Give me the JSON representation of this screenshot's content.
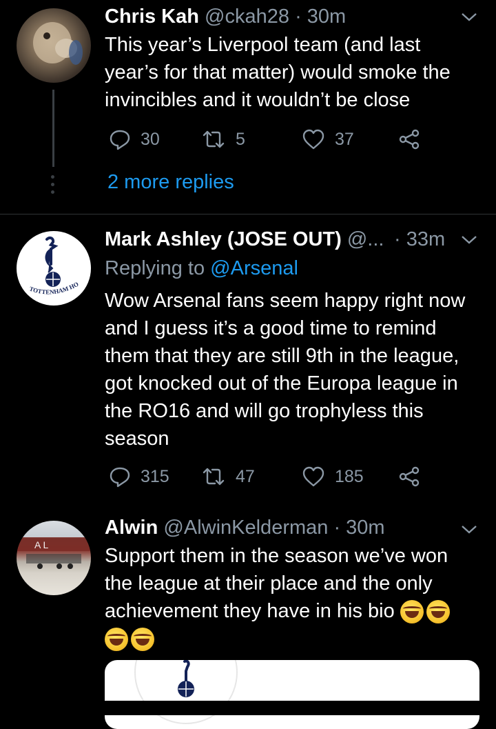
{
  "tweets": [
    {
      "name": "Chris Kah",
      "handle": "@ckah28",
      "time": "· 30m",
      "text_lines": [
        "This year’s Liverpool team (and last",
        "year’s for that matter) would smoke the",
        "invincibles and it wouldn’t be close"
      ],
      "replies": "30",
      "retweets": "5",
      "likes": "37",
      "more_replies": "2 more replies"
    },
    {
      "name": "Mark Ashley (JOSE OUT)",
      "handle": "@...",
      "time": "· 33m",
      "replying_prefix": "Replying to",
      "replying_to": "@Arsenal",
      "avatar_text": "TOTTENHAM HOTSPUR",
      "text_lines": [
        "Wow Arsenal fans seem happy right now",
        "and I guess it’s a good time to remind",
        "them that they are still 9th in the league,",
        "got knocked out of the Europa league in",
        "the RO16 and will go trophyless this",
        "season"
      ],
      "replies": "315",
      "retweets": "47",
      "likes": "185"
    },
    {
      "name": "Alwin",
      "handle": "@AlwinKelderman",
      "time": "· 30m",
      "avatar_text": "A L",
      "text_lines": [
        "Support them in the season we’ve won",
        "the league at their place and the only",
        "achievement they have in his bio"
      ],
      "emoji": "face-with-tears-of-joy"
    }
  ],
  "colors": {
    "background": "#000000",
    "secondary_text": "#8b98a5",
    "link": "#1d9bf0",
    "divider": "#2f3336"
  }
}
